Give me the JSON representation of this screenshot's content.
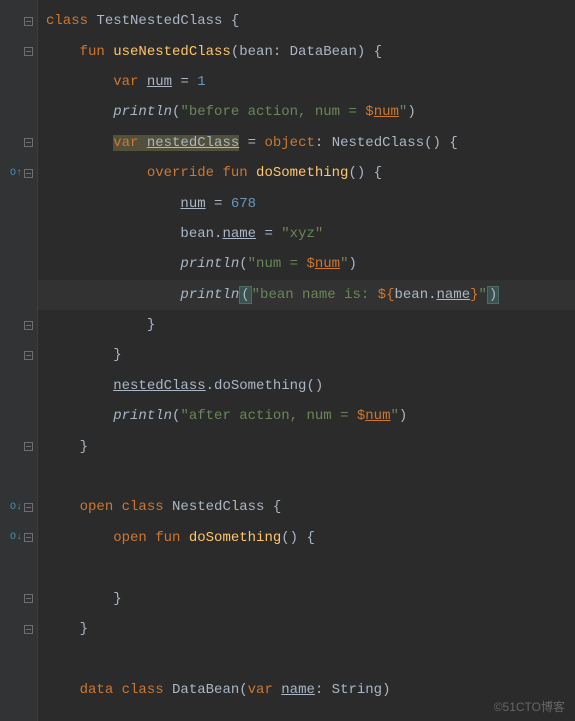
{
  "code": {
    "lines": [
      {
        "indent": 0,
        "tokens": [
          {
            "t": "class ",
            "c": "kw"
          },
          {
            "t": "TestNestedClass {",
            "c": "id"
          }
        ]
      },
      {
        "indent": 1,
        "tokens": [
          {
            "t": "fun ",
            "c": "kw"
          },
          {
            "t": "useNestedClass",
            "c": "fn"
          },
          {
            "t": "(bean: DataBean) {",
            "c": "id"
          }
        ]
      },
      {
        "indent": 2,
        "tokens": [
          {
            "t": "var ",
            "c": "kw"
          },
          {
            "t": "num",
            "c": "id underline"
          },
          {
            "t": " = ",
            "c": "id"
          },
          {
            "t": "1",
            "c": "num"
          }
        ]
      },
      {
        "indent": 2,
        "tokens": [
          {
            "t": "println",
            "c": "id italic"
          },
          {
            "t": "(",
            "c": "id"
          },
          {
            "t": "\"before action, num = ",
            "c": "str"
          },
          {
            "t": "$",
            "c": "tmpl"
          },
          {
            "t": "num",
            "c": "tmpl underline"
          },
          {
            "t": "\"",
            "c": "str"
          },
          {
            "t": ")",
            "c": "id"
          }
        ]
      },
      {
        "indent": 2,
        "tokens": [
          {
            "t": "var ",
            "c": "kw warn-bg"
          },
          {
            "t": "nestedClass",
            "c": "id underline warn-bg"
          },
          {
            "t": " = ",
            "c": "id"
          },
          {
            "t": "object",
            "c": "kw"
          },
          {
            "t": ": NestedClass() {",
            "c": "id"
          }
        ]
      },
      {
        "indent": 3,
        "tokens": [
          {
            "t": "override fun ",
            "c": "kw"
          },
          {
            "t": "doSomething",
            "c": "fn"
          },
          {
            "t": "() {",
            "c": "id"
          }
        ]
      },
      {
        "indent": 4,
        "tokens": [
          {
            "t": "num",
            "c": "id underline"
          },
          {
            "t": " = ",
            "c": "id"
          },
          {
            "t": "678",
            "c": "num"
          }
        ]
      },
      {
        "indent": 4,
        "tokens": [
          {
            "t": "bean.",
            "c": "id"
          },
          {
            "t": "name",
            "c": "id underline"
          },
          {
            "t": " = ",
            "c": "id"
          },
          {
            "t": "\"xyz\"",
            "c": "str"
          }
        ]
      },
      {
        "indent": 4,
        "tokens": [
          {
            "t": "println",
            "c": "id italic"
          },
          {
            "t": "(",
            "c": "id"
          },
          {
            "t": "\"num = ",
            "c": "str"
          },
          {
            "t": "$",
            "c": "tmpl"
          },
          {
            "t": "num",
            "c": "tmpl underline"
          },
          {
            "t": "\"",
            "c": "str"
          },
          {
            "t": ")",
            "c": "id"
          }
        ]
      },
      {
        "indent": 4,
        "hl": true,
        "tokens": [
          {
            "t": "println",
            "c": "id italic"
          },
          {
            "t": "(",
            "c": "id brace-hl"
          },
          {
            "t": "\"bean name is: ",
            "c": "str"
          },
          {
            "t": "${",
            "c": "tmpl"
          },
          {
            "t": "bean.",
            "c": "id"
          },
          {
            "t": "name",
            "c": "id underline"
          },
          {
            "t": "}",
            "c": "tmpl"
          },
          {
            "t": "\"",
            "c": "str"
          },
          {
            "t": ")",
            "c": "id brace-hl caret-bg"
          }
        ]
      },
      {
        "indent": 3,
        "tokens": [
          {
            "t": "}",
            "c": "id"
          }
        ]
      },
      {
        "indent": 2,
        "tokens": [
          {
            "t": "}",
            "c": "id"
          }
        ]
      },
      {
        "indent": 2,
        "tokens": [
          {
            "t": "nestedClass",
            "c": "id underline"
          },
          {
            "t": ".doSomething()",
            "c": "id"
          }
        ]
      },
      {
        "indent": 2,
        "tokens": [
          {
            "t": "println",
            "c": "id italic"
          },
          {
            "t": "(",
            "c": "id"
          },
          {
            "t": "\"after action, num = ",
            "c": "str"
          },
          {
            "t": "$",
            "c": "tmpl"
          },
          {
            "t": "num",
            "c": "tmpl underline"
          },
          {
            "t": "\"",
            "c": "str"
          },
          {
            "t": ")",
            "c": "id"
          }
        ]
      },
      {
        "indent": 1,
        "tokens": [
          {
            "t": "}",
            "c": "id"
          }
        ]
      },
      {
        "indent": 0,
        "tokens": []
      },
      {
        "indent": 1,
        "tokens": [
          {
            "t": "open class ",
            "c": "kw"
          },
          {
            "t": "NestedClass {",
            "c": "id"
          }
        ]
      },
      {
        "indent": 2,
        "tokens": [
          {
            "t": "open fun ",
            "c": "kw"
          },
          {
            "t": "doSomething",
            "c": "fn"
          },
          {
            "t": "() {",
            "c": "id"
          }
        ]
      },
      {
        "indent": 0,
        "tokens": []
      },
      {
        "indent": 2,
        "tokens": [
          {
            "t": "}",
            "c": "id"
          }
        ]
      },
      {
        "indent": 1,
        "tokens": [
          {
            "t": "}",
            "c": "id"
          }
        ]
      },
      {
        "indent": 0,
        "tokens": []
      },
      {
        "indent": 1,
        "tokens": [
          {
            "t": "data class ",
            "c": "kw"
          },
          {
            "t": "DataBean(",
            "c": "id"
          },
          {
            "t": "var ",
            "c": "kw"
          },
          {
            "t": "name",
            "c": "id underline"
          },
          {
            "t": ": String)",
            "c": "id"
          }
        ]
      }
    ]
  },
  "gutter": {
    "rows": [
      {
        "fold": true
      },
      {
        "fold": true
      },
      {},
      {},
      {
        "fold": true
      },
      {
        "icon": "O↑",
        "fold": true
      },
      {},
      {},
      {},
      {},
      {
        "fold": true
      },
      {
        "fold": true
      },
      {},
      {},
      {
        "fold": true
      },
      {},
      {
        "icon": "O↓",
        "fold": true
      },
      {
        "icon": "O↓",
        "fold": true
      },
      {},
      {
        "fold": true
      },
      {
        "fold": true
      },
      {},
      {}
    ]
  },
  "watermark": "©51CTO博客",
  "indent_unit": "    "
}
